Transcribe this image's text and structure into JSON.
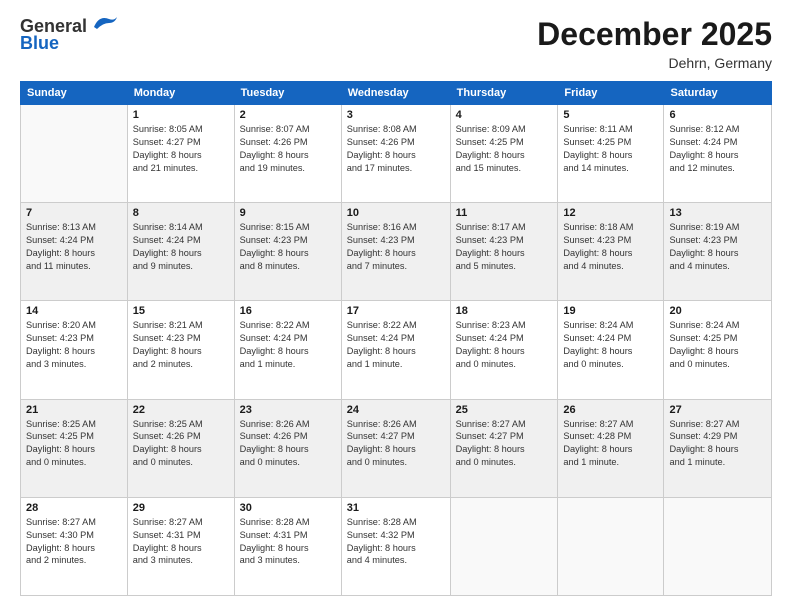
{
  "logo": {
    "line1": "General",
    "line2": "Blue"
  },
  "title": "December 2025",
  "subtitle": "Dehrn, Germany",
  "days_of_week": [
    "Sunday",
    "Monday",
    "Tuesday",
    "Wednesday",
    "Thursday",
    "Friday",
    "Saturday"
  ],
  "weeks": [
    [
      {
        "day": "",
        "detail": ""
      },
      {
        "day": "1",
        "detail": "Sunrise: 8:05 AM\nSunset: 4:27 PM\nDaylight: 8 hours\nand 21 minutes."
      },
      {
        "day": "2",
        "detail": "Sunrise: 8:07 AM\nSunset: 4:26 PM\nDaylight: 8 hours\nand 19 minutes."
      },
      {
        "day": "3",
        "detail": "Sunrise: 8:08 AM\nSunset: 4:26 PM\nDaylight: 8 hours\nand 17 minutes."
      },
      {
        "day": "4",
        "detail": "Sunrise: 8:09 AM\nSunset: 4:25 PM\nDaylight: 8 hours\nand 15 minutes."
      },
      {
        "day": "5",
        "detail": "Sunrise: 8:11 AM\nSunset: 4:25 PM\nDaylight: 8 hours\nand 14 minutes."
      },
      {
        "day": "6",
        "detail": "Sunrise: 8:12 AM\nSunset: 4:24 PM\nDaylight: 8 hours\nand 12 minutes."
      }
    ],
    [
      {
        "day": "7",
        "detail": "Sunrise: 8:13 AM\nSunset: 4:24 PM\nDaylight: 8 hours\nand 11 minutes."
      },
      {
        "day": "8",
        "detail": "Sunrise: 8:14 AM\nSunset: 4:24 PM\nDaylight: 8 hours\nand 9 minutes."
      },
      {
        "day": "9",
        "detail": "Sunrise: 8:15 AM\nSunset: 4:23 PM\nDaylight: 8 hours\nand 8 minutes."
      },
      {
        "day": "10",
        "detail": "Sunrise: 8:16 AM\nSunset: 4:23 PM\nDaylight: 8 hours\nand 7 minutes."
      },
      {
        "day": "11",
        "detail": "Sunrise: 8:17 AM\nSunset: 4:23 PM\nDaylight: 8 hours\nand 5 minutes."
      },
      {
        "day": "12",
        "detail": "Sunrise: 8:18 AM\nSunset: 4:23 PM\nDaylight: 8 hours\nand 4 minutes."
      },
      {
        "day": "13",
        "detail": "Sunrise: 8:19 AM\nSunset: 4:23 PM\nDaylight: 8 hours\nand 4 minutes."
      }
    ],
    [
      {
        "day": "14",
        "detail": "Sunrise: 8:20 AM\nSunset: 4:23 PM\nDaylight: 8 hours\nand 3 minutes."
      },
      {
        "day": "15",
        "detail": "Sunrise: 8:21 AM\nSunset: 4:23 PM\nDaylight: 8 hours\nand 2 minutes."
      },
      {
        "day": "16",
        "detail": "Sunrise: 8:22 AM\nSunset: 4:24 PM\nDaylight: 8 hours\nand 1 minute."
      },
      {
        "day": "17",
        "detail": "Sunrise: 8:22 AM\nSunset: 4:24 PM\nDaylight: 8 hours\nand 1 minute."
      },
      {
        "day": "18",
        "detail": "Sunrise: 8:23 AM\nSunset: 4:24 PM\nDaylight: 8 hours\nand 0 minutes."
      },
      {
        "day": "19",
        "detail": "Sunrise: 8:24 AM\nSunset: 4:24 PM\nDaylight: 8 hours\nand 0 minutes."
      },
      {
        "day": "20",
        "detail": "Sunrise: 8:24 AM\nSunset: 4:25 PM\nDaylight: 8 hours\nand 0 minutes."
      }
    ],
    [
      {
        "day": "21",
        "detail": "Sunrise: 8:25 AM\nSunset: 4:25 PM\nDaylight: 8 hours\nand 0 minutes."
      },
      {
        "day": "22",
        "detail": "Sunrise: 8:25 AM\nSunset: 4:26 PM\nDaylight: 8 hours\nand 0 minutes."
      },
      {
        "day": "23",
        "detail": "Sunrise: 8:26 AM\nSunset: 4:26 PM\nDaylight: 8 hours\nand 0 minutes."
      },
      {
        "day": "24",
        "detail": "Sunrise: 8:26 AM\nSunset: 4:27 PM\nDaylight: 8 hours\nand 0 minutes."
      },
      {
        "day": "25",
        "detail": "Sunrise: 8:27 AM\nSunset: 4:27 PM\nDaylight: 8 hours\nand 0 minutes."
      },
      {
        "day": "26",
        "detail": "Sunrise: 8:27 AM\nSunset: 4:28 PM\nDaylight: 8 hours\nand 1 minute."
      },
      {
        "day": "27",
        "detail": "Sunrise: 8:27 AM\nSunset: 4:29 PM\nDaylight: 8 hours\nand 1 minute."
      }
    ],
    [
      {
        "day": "28",
        "detail": "Sunrise: 8:27 AM\nSunset: 4:30 PM\nDaylight: 8 hours\nand 2 minutes."
      },
      {
        "day": "29",
        "detail": "Sunrise: 8:27 AM\nSunset: 4:31 PM\nDaylight: 8 hours\nand 3 minutes."
      },
      {
        "day": "30",
        "detail": "Sunrise: 8:28 AM\nSunset: 4:31 PM\nDaylight: 8 hours\nand 3 minutes."
      },
      {
        "day": "31",
        "detail": "Sunrise: 8:28 AM\nSunset: 4:32 PM\nDaylight: 8 hours\nand 4 minutes."
      },
      {
        "day": "",
        "detail": ""
      },
      {
        "day": "",
        "detail": ""
      },
      {
        "day": "",
        "detail": ""
      }
    ]
  ]
}
